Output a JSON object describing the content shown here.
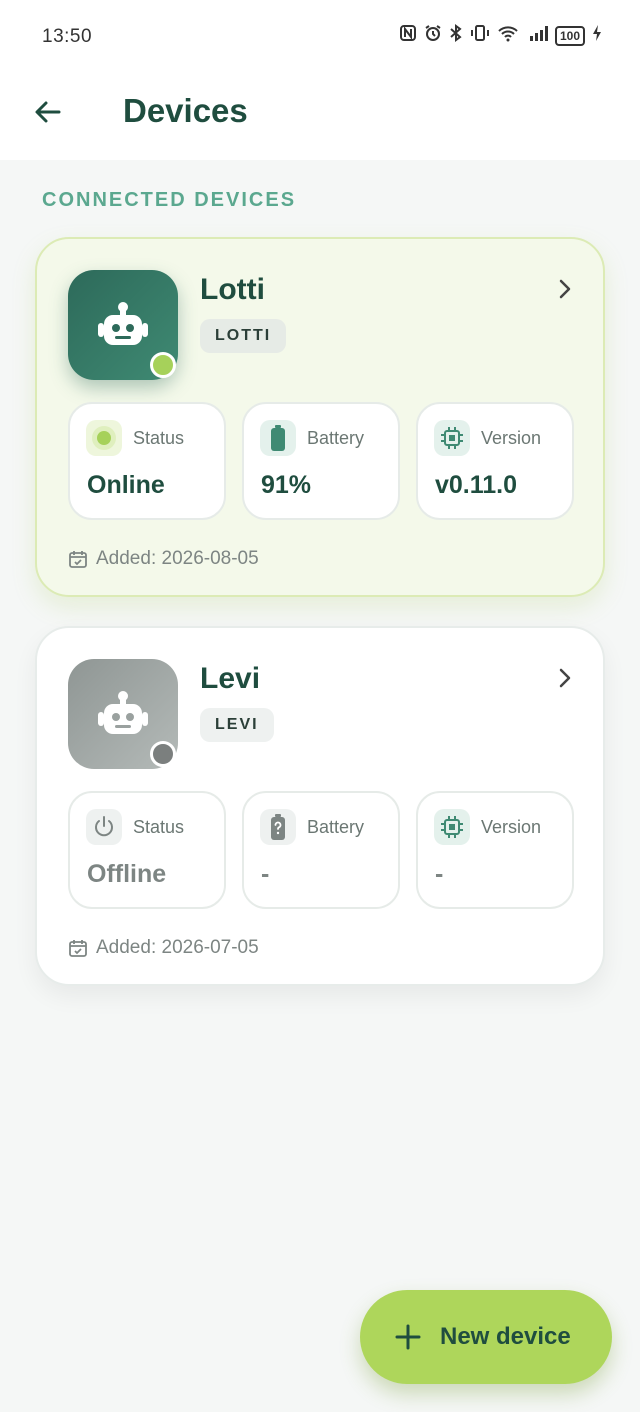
{
  "status_bar": {
    "time": "13:50",
    "battery": "100"
  },
  "header": {
    "title": "Devices"
  },
  "section": {
    "title": "CONNECTED DEVICES"
  },
  "devices": [
    {
      "name": "Lotti",
      "tag": "LOTTI",
      "connection": "online",
      "stats": [
        {
          "label": "Status",
          "value": "Online",
          "icon": "online-dot-icon"
        },
        {
          "label": "Battery",
          "value": "91%",
          "icon": "battery-icon"
        },
        {
          "label": "Version",
          "value": "v0.11.0",
          "icon": "chip-icon"
        }
      ],
      "added": "Added: 2026-08-05"
    },
    {
      "name": "Levi",
      "tag": "LEVI",
      "connection": "offline",
      "stats": [
        {
          "label": "Status",
          "value": "Offline",
          "icon": "power-icon"
        },
        {
          "label": "Battery",
          "value": "-",
          "icon": "battery-unknown-icon"
        },
        {
          "label": "Version",
          "value": "-",
          "icon": "chip-icon"
        }
      ],
      "added": "Added: 2026-07-05"
    }
  ],
  "fab": {
    "label": "New device",
    "icon": "plus-icon"
  },
  "colors": {
    "accent": "#aed65b",
    "primary_text": "#1f4d3f",
    "section_title": "#5ba88f",
    "online_dot": "#a6d15a",
    "offline_dot": "#7b7f7e"
  }
}
